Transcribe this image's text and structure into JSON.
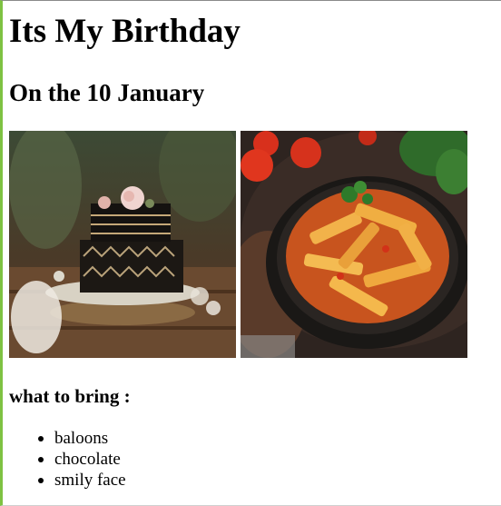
{
  "page": {
    "title": "Its My Birthday",
    "date_line": "On the 10 January",
    "bring_heading": "what to bring :",
    "bring_items": [
      "baloons",
      "chocolate",
      "smily face"
    ]
  },
  "images": {
    "cake": "birthday-cake-image",
    "pasta": "penne-pasta-image"
  },
  "colors": {
    "accent_left_border": "#7ec242"
  }
}
